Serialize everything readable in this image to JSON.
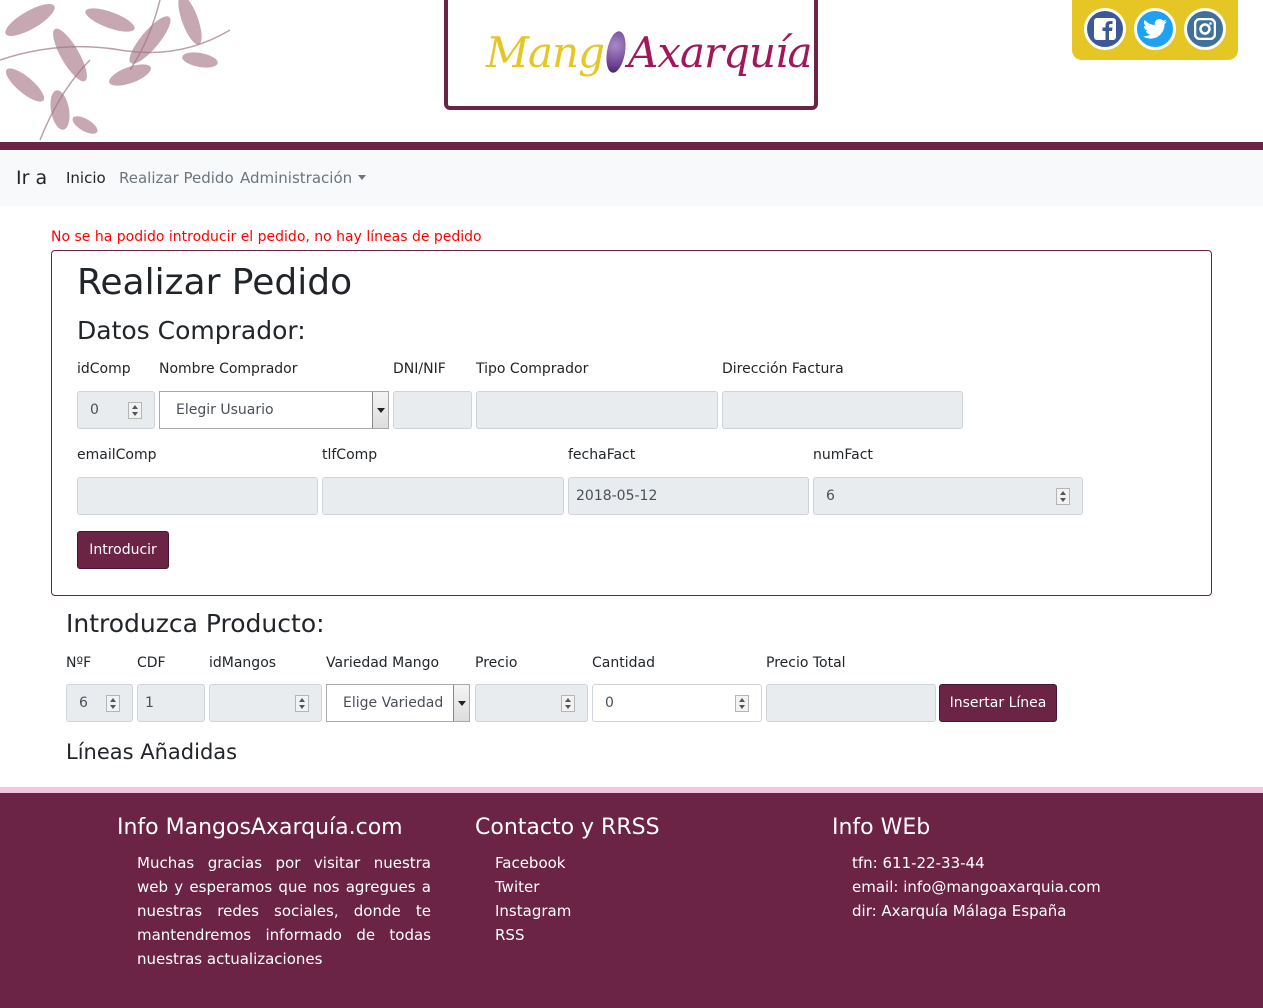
{
  "header": {
    "logo": {
      "part1": "Mang",
      "part2": "Axarquía"
    },
    "social": [
      "facebook-icon",
      "twitter-icon",
      "instagram-icon"
    ],
    "colors": {
      "brand": "#6b2446",
      "accent": "#e6c624",
      "error": "#ff0000"
    }
  },
  "nav": {
    "brand": "Ir a",
    "items": [
      {
        "label": "Inicio"
      },
      {
        "label": "Realizar Pedido"
      },
      {
        "label": "Administración"
      }
    ]
  },
  "error": "No se ha podido introducir el pedido, no hay líneas de pedido",
  "form": {
    "title": "Realizar Pedido",
    "subtitle": "Datos Comprador:",
    "labels": {
      "idComp": "idComp",
      "nombre": "Nombre Comprador",
      "dni": "DNI/NIF",
      "tipo": "Tipo Comprador",
      "direccion": "Dirección Factura",
      "email": "emailComp",
      "tlf": "tlfComp",
      "fecha": "fechaFact",
      "numFact": "numFact"
    },
    "values": {
      "idComp": "0",
      "nombre": "Elegir Usuario",
      "dni": "",
      "tipo": "",
      "direccion": "",
      "email": "",
      "tlf": "",
      "fecha": "2018-05-12",
      "numFact": "6"
    },
    "submit": "Introducir"
  },
  "product": {
    "title": "Introduzca Producto:",
    "labels": {
      "nf": "NºF",
      "cdf": "CDF",
      "idMangos": "idMangos",
      "variedad": "Variedad Mango",
      "precio": "Precio",
      "cantidad": "Cantidad",
      "total": "Precio Total"
    },
    "values": {
      "nf": "6",
      "cdf": "1",
      "idMangos": "",
      "variedad": "Elige Variedad",
      "precio": "",
      "cantidad": "0",
      "total": ""
    },
    "insert": "Insertar Línea",
    "lines_title": "Líneas Añadidas"
  },
  "footer": {
    "col1": {
      "title": "Info MangosAxarquía.com",
      "text": "Muchas gracias por visitar nuestra web y esperamos que nos agregues a nuestras redes sociales, donde te mantendremos informado de todas nuestras actualizaciones"
    },
    "col2": {
      "title": "Contacto y RRSS",
      "links": [
        "Facebook",
        "Twiter",
        "Instagram",
        "RSS"
      ]
    },
    "col3": {
      "title": "Info WEb",
      "lines": [
        "tfn: 611-22-33-44",
        "email: info@mangoaxarquia.com",
        "dir: Axarquía Málaga España"
      ]
    }
  }
}
